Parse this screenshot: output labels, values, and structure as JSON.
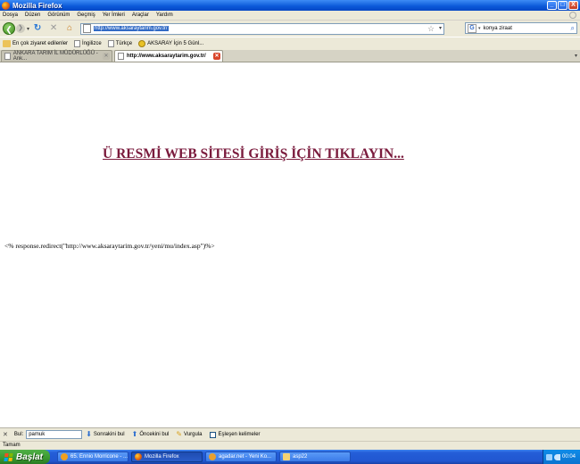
{
  "window": {
    "title": "Mozilla Firefox",
    "buttons": {
      "minimize": "_",
      "maximize": "□",
      "close": "X"
    }
  },
  "menu": [
    "Dosya",
    "Düzen",
    "Görünüm",
    "Geçmiş",
    "Yer İmleri",
    "Araçlar",
    "Yardım"
  ],
  "nav": {
    "url": "http://www.aksaraytarim.gov.tr/",
    "search_engine": "G",
    "search_text": "konya ziraat"
  },
  "bookmarks": [
    {
      "label": "En çok ziyaret edilenler",
      "icon": "star-icon"
    },
    {
      "label": "İngilizce",
      "icon": "page-icon"
    },
    {
      "label": "Türkçe",
      "icon": "page-icon"
    },
    {
      "label": "AKSARAY İçin 5 Günl...",
      "icon": "weather-icon"
    }
  ],
  "tabs": [
    {
      "label": "ANKARA TARIM İL MÜDÜRLÜĞÜ - Ank...",
      "active": false
    },
    {
      "label": "http://www.aksaraytarim.gov.tr/",
      "active": true
    }
  ],
  "content": {
    "link_text": "Ü RESMİ WEB SİTESİ GİRİŞ İÇİN TIKLAYIN...",
    "raw_code": "<% response.redirect(\"http://www.aksaraytarim.gov.tr/yeni/mu/index.asp\")%>"
  },
  "findbar": {
    "label": "Bul:",
    "value": "pamuk",
    "next": "Sonrakini bul",
    "prev": "Öncekini bul",
    "highlight": "Vurgula",
    "match_case": "Eşleşen kelimeler"
  },
  "status": "Tamam",
  "taskbar": {
    "start": "Başlat",
    "tasks": [
      {
        "label": "65. Ennio Morricone - ...",
        "icon": "media",
        "active": false
      },
      {
        "label": "Mozilla Firefox",
        "icon": "ff",
        "active": true
      },
      {
        "label": "agadar.net - Yeni Ko...",
        "icon": "ie",
        "active": false
      },
      {
        "label": "asp22",
        "icon": "folder",
        "active": false
      }
    ],
    "clock": "00:04"
  }
}
